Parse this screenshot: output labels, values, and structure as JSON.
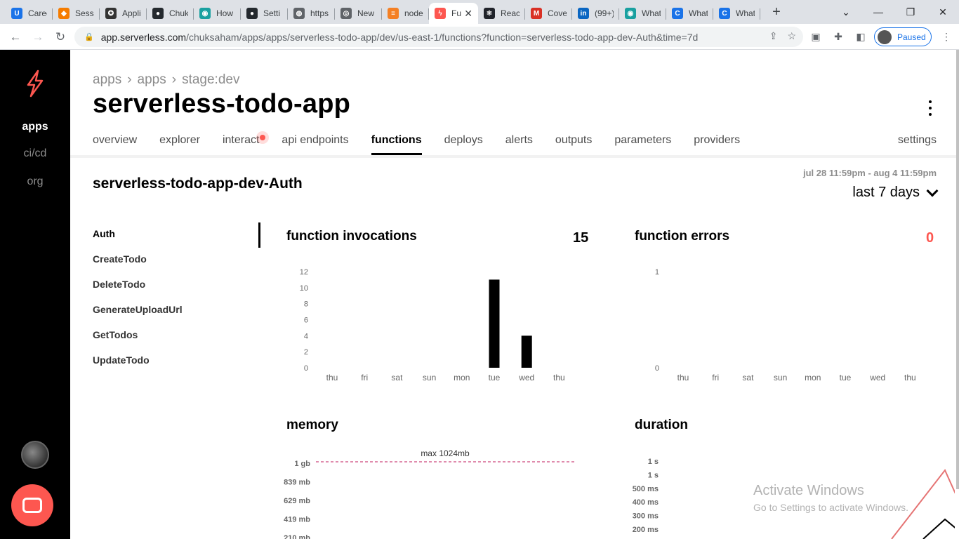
{
  "browser": {
    "tabs": [
      {
        "label": "Caree",
        "color": "#1a73e8",
        "glyph": "U"
      },
      {
        "label": "Sessi",
        "color": "#f57c00",
        "glyph": "◆"
      },
      {
        "label": "Appli",
        "color": "#333333",
        "glyph": "✪"
      },
      {
        "label": "Chuk",
        "color": "#24292e",
        "glyph": "●"
      },
      {
        "label": "How",
        "color": "#19a0a0",
        "glyph": "◉"
      },
      {
        "label": "Setti",
        "color": "#24292e",
        "glyph": "●"
      },
      {
        "label": "https",
        "color": "#5f6368",
        "glyph": "◍"
      },
      {
        "label": "New",
        "color": "#5f6368",
        "glyph": "◎"
      },
      {
        "label": "node",
        "color": "#f48024",
        "glyph": "≡"
      },
      {
        "label": "Fu",
        "color": "#fd5750",
        "glyph": "ϟ",
        "active": true
      },
      {
        "label": "React",
        "color": "#20232a",
        "glyph": "⚛"
      },
      {
        "label": "Cove",
        "color": "#d93025",
        "glyph": "M"
      },
      {
        "label": "(99+)",
        "color": "#0a66c2",
        "glyph": "in"
      },
      {
        "label": "What",
        "color": "#19a0a0",
        "glyph": "◉"
      },
      {
        "label": "What",
        "color": "#1a73e8",
        "glyph": "C"
      },
      {
        "label": "What",
        "color": "#1a73e8",
        "glyph": "C"
      }
    ],
    "url_host": "app.serverless.com",
    "url_path": "/chuksaham/apps/apps/serverless-todo-app/dev/us-east-1/functions?function=serverless-todo-app-dev-Auth&time=7d",
    "profile_label": "Paused"
  },
  "sidebar": {
    "items": [
      {
        "label": "apps",
        "active": true
      },
      {
        "label": "ci/cd",
        "active": false
      },
      {
        "label": "org",
        "active": false
      }
    ]
  },
  "header": {
    "breadcrumb": [
      "apps",
      "apps",
      "stage:dev"
    ],
    "title": "serverless-todo-app"
  },
  "tabs": {
    "items": [
      "overview",
      "explorer",
      "interact",
      "api endpoints",
      "functions",
      "deploys",
      "alerts",
      "outputs",
      "parameters",
      "providers"
    ],
    "active": "functions",
    "settings": "settings"
  },
  "function": {
    "name": "serverless-todo-app-dev-Auth",
    "date_range": "jul 28 11:59pm - aug 4 11:59pm",
    "period": "last 7 days",
    "list": [
      "Auth",
      "CreateTodo",
      "DeleteTodo",
      "GenerateUploadUrl",
      "GetTodos",
      "UpdateTodo"
    ],
    "active": "Auth"
  },
  "cards": {
    "invocations_title": "function invocations",
    "invocations_total": "15",
    "errors_title": "function errors",
    "errors_total": "0",
    "memory_title": "memory",
    "memory_max_label": "max 1024mb",
    "memory_ticks": [
      "1 gb",
      "839 mb",
      "629 mb",
      "419 mb",
      "210 mb"
    ],
    "duration_title": "duration",
    "duration_ticks": [
      "1 s",
      "1 s",
      "500 ms",
      "400 ms",
      "300 ms",
      "200 ms"
    ]
  },
  "chart_data": [
    {
      "type": "bar",
      "title": "function invocations",
      "categories": [
        "thu",
        "fri",
        "sat",
        "sun",
        "mon",
        "tue",
        "wed",
        "thu"
      ],
      "values": [
        0,
        0,
        0,
        0,
        0,
        11,
        4,
        0
      ],
      "yticks": [
        0,
        2,
        4,
        6,
        8,
        10,
        12
      ],
      "ylim": [
        0,
        12
      ],
      "color": "#000000"
    },
    {
      "type": "bar",
      "title": "function errors",
      "categories": [
        "thu",
        "fri",
        "sat",
        "sun",
        "mon",
        "tue",
        "wed",
        "thu"
      ],
      "values": [
        0,
        0,
        0,
        0,
        0,
        0,
        0,
        0
      ],
      "yticks": [
        0,
        1
      ],
      "ylim": [
        0,
        1
      ],
      "color": "#fd5750"
    }
  ],
  "watermark": {
    "line1": "Activate Windows",
    "line2": "Go to Settings to activate Windows."
  },
  "colors": {
    "accent": "#fd5750",
    "error": "#fd5750"
  }
}
